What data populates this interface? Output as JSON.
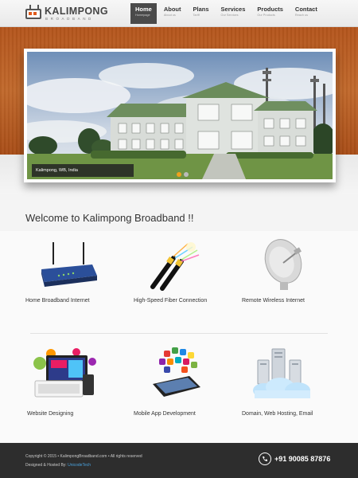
{
  "brand": {
    "name": "KALIMPONG",
    "tagline": "BROADBAND"
  },
  "nav": [
    {
      "label": "Home",
      "sub": "Homepage",
      "active": true
    },
    {
      "label": "About",
      "sub": "About us",
      "active": false
    },
    {
      "label": "Plans",
      "sub": "Tariff",
      "active": false
    },
    {
      "label": "Services",
      "sub": "Our Services",
      "active": false
    },
    {
      "label": "Products",
      "sub": "Our Products",
      "active": false
    },
    {
      "label": "Contact",
      "sub": "Reach us",
      "active": false
    }
  ],
  "slider": {
    "caption": "Kalimpong, WB, India",
    "active_slide": 1,
    "slide_count": 2
  },
  "welcome": "Welcome to Kalimpong Broadband !!",
  "services": [
    {
      "label": "Home Broadband Internet",
      "icon": "router-icon"
    },
    {
      "label": "High-Speed Fiber Connection",
      "icon": "fiber-cable-icon"
    },
    {
      "label": "Remote Wireless Internet",
      "icon": "satellite-dish-icon"
    },
    {
      "label": "Website Designing",
      "icon": "web-design-icon"
    },
    {
      "label": "Mobile App Development",
      "icon": "mobile-apps-icon"
    },
    {
      "label": "Domain, Web Hosting, Email",
      "icon": "cloud-hosting-icon"
    }
  ],
  "footer": {
    "copyright": "Copyright © 2015 • KalimpongBroadband.com • All rights reserved",
    "designed_prefix": "Designed & Hosted By:",
    "designed_link": "UnicodeTech",
    "phone": "+91 90085 87876"
  },
  "colors": {
    "accent": "#f0a11c",
    "banner": "#b4551c",
    "footer": "#2d2d2d",
    "nav_active": "#4a4a4a"
  }
}
